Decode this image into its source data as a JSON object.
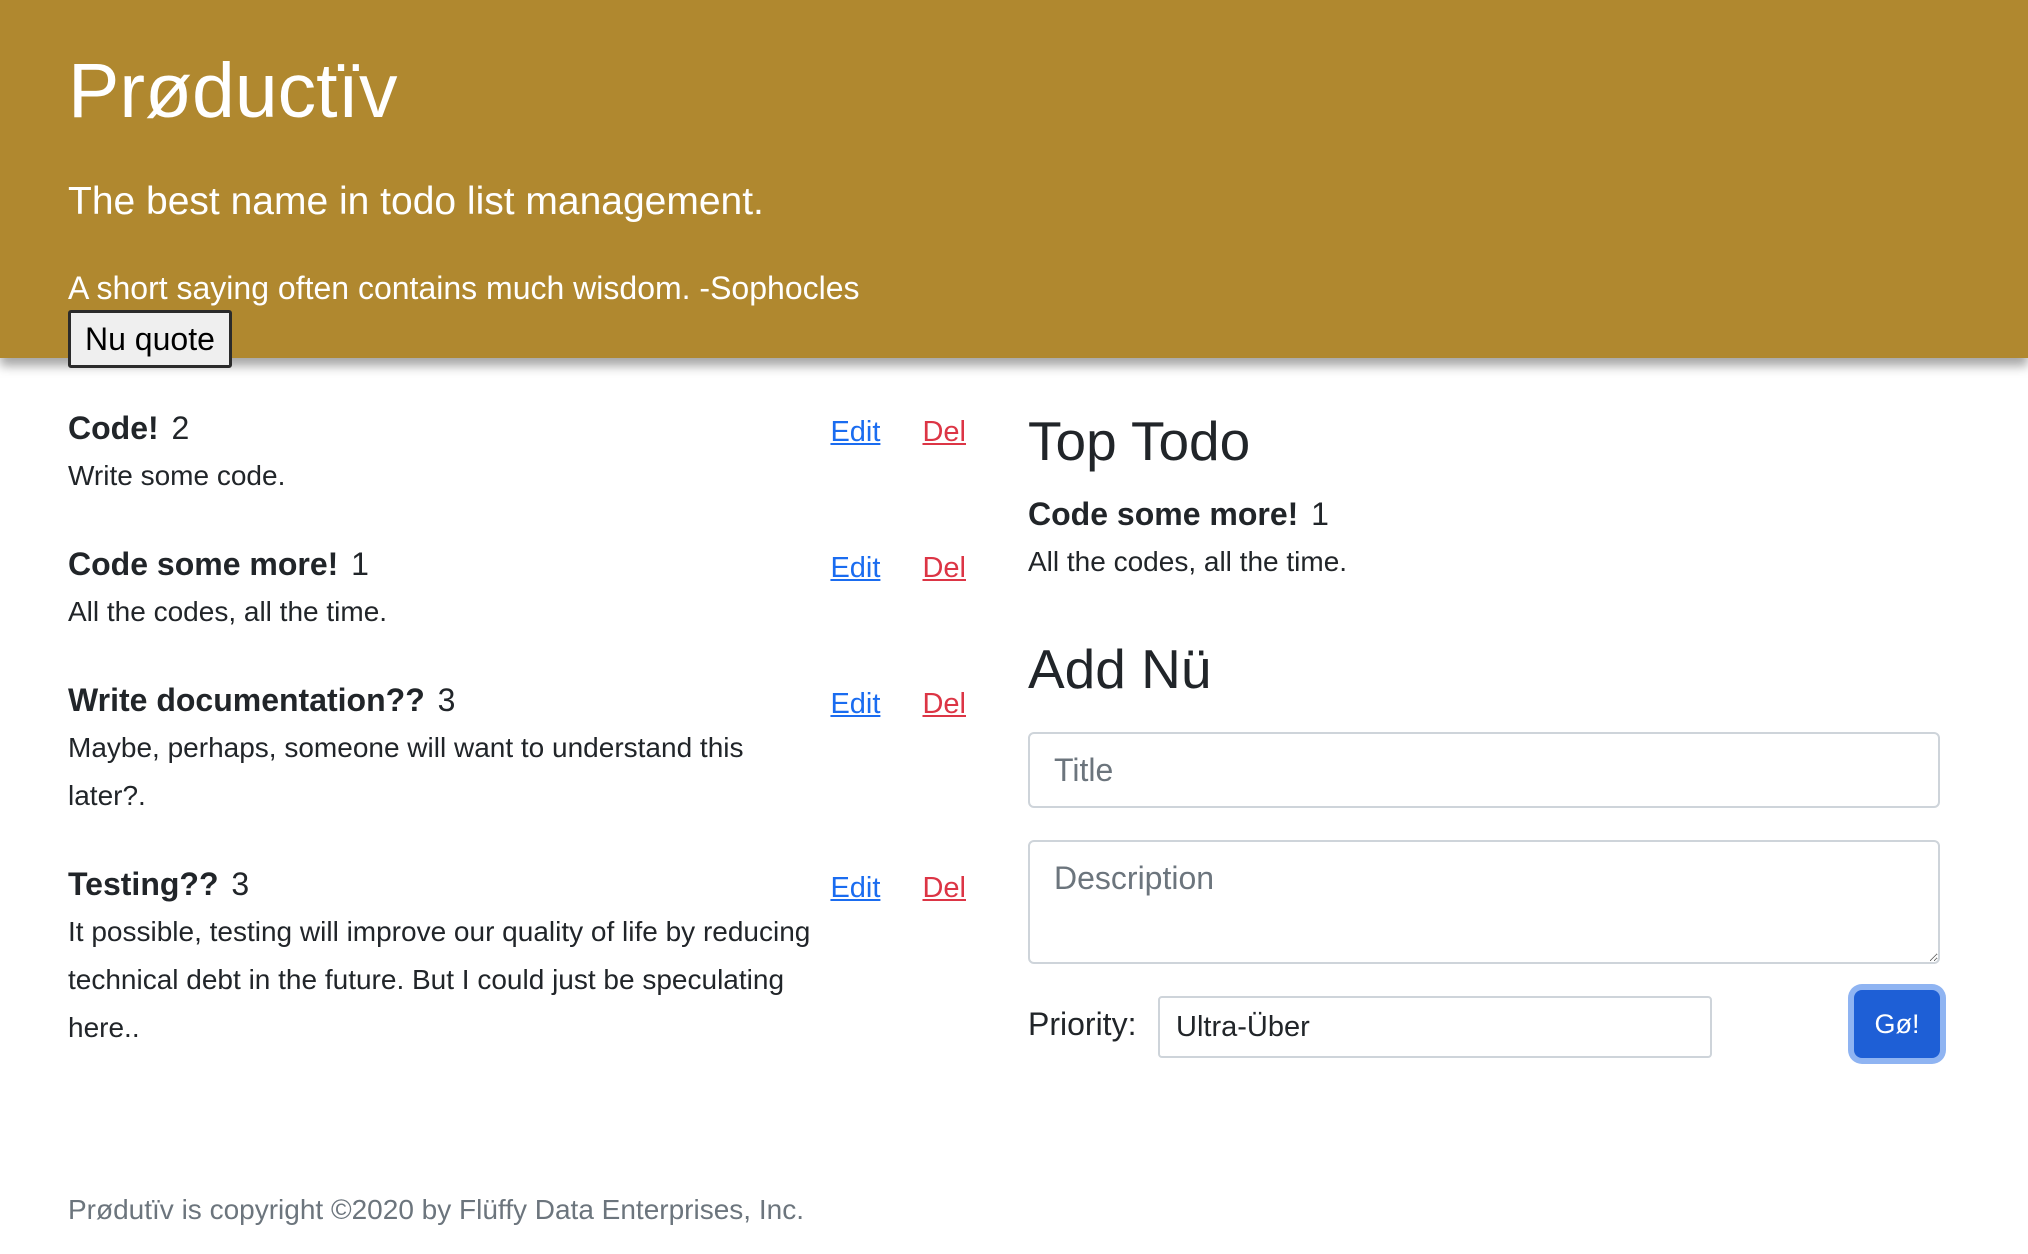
{
  "header": {
    "app_title": "Prøductïv",
    "tagline": "The best name in todo list management.",
    "quote": "A short saying often contains much wisdom. -Sophocles",
    "quote_button": "Nu quote",
    "background_color": "#b0882f"
  },
  "todos": [
    {
      "title": "Code!",
      "priority": "2",
      "description": "Write some code.",
      "edit_label": "Edit",
      "del_label": "Del"
    },
    {
      "title": "Code some more!",
      "priority": "1",
      "description": "All the codes, all the time.",
      "edit_label": "Edit",
      "del_label": "Del"
    },
    {
      "title": "Write documentation??",
      "priority": "3",
      "description": "Maybe, perhaps, someone will want to understand this later?.",
      "edit_label": "Edit",
      "del_label": "Del"
    },
    {
      "title": "Testing??",
      "priority": "3",
      "description": "It possible, testing will improve our quality of life by reducing technical debt in the future. But I could just be speculating here..",
      "edit_label": "Edit",
      "del_label": "Del"
    }
  ],
  "top_todo": {
    "heading": "Top Todo",
    "title": "Code some more!",
    "priority": "1",
    "description": "All the codes, all the time."
  },
  "add_form": {
    "heading": "Add Nü",
    "title_placeholder": "Title",
    "description_placeholder": "Description",
    "priority_label": "Priority:",
    "priority_value": "Ultra-Über",
    "submit_label": "Gø!"
  },
  "footer": {
    "text": "Prødutïv is copyright ©2020 by Flüffy Data Enterprises, Inc."
  }
}
